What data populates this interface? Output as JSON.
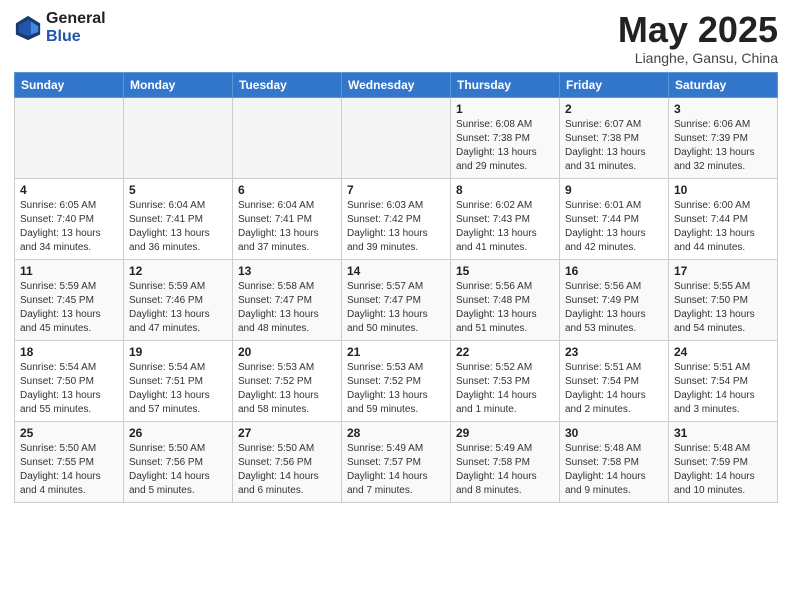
{
  "header": {
    "logo_general": "General",
    "logo_blue": "Blue",
    "month_title": "May 2025",
    "location": "Lianghe, Gansu, China"
  },
  "weekdays": [
    "Sunday",
    "Monday",
    "Tuesday",
    "Wednesday",
    "Thursday",
    "Friday",
    "Saturday"
  ],
  "rows": [
    [
      {
        "day": "",
        "info": ""
      },
      {
        "day": "",
        "info": ""
      },
      {
        "day": "",
        "info": ""
      },
      {
        "day": "",
        "info": ""
      },
      {
        "day": "1",
        "info": "Sunrise: 6:08 AM\nSunset: 7:38 PM\nDaylight: 13 hours\nand 29 minutes."
      },
      {
        "day": "2",
        "info": "Sunrise: 6:07 AM\nSunset: 7:38 PM\nDaylight: 13 hours\nand 31 minutes."
      },
      {
        "day": "3",
        "info": "Sunrise: 6:06 AM\nSunset: 7:39 PM\nDaylight: 13 hours\nand 32 minutes."
      }
    ],
    [
      {
        "day": "4",
        "info": "Sunrise: 6:05 AM\nSunset: 7:40 PM\nDaylight: 13 hours\nand 34 minutes."
      },
      {
        "day": "5",
        "info": "Sunrise: 6:04 AM\nSunset: 7:41 PM\nDaylight: 13 hours\nand 36 minutes."
      },
      {
        "day": "6",
        "info": "Sunrise: 6:04 AM\nSunset: 7:41 PM\nDaylight: 13 hours\nand 37 minutes."
      },
      {
        "day": "7",
        "info": "Sunrise: 6:03 AM\nSunset: 7:42 PM\nDaylight: 13 hours\nand 39 minutes."
      },
      {
        "day": "8",
        "info": "Sunrise: 6:02 AM\nSunset: 7:43 PM\nDaylight: 13 hours\nand 41 minutes."
      },
      {
        "day": "9",
        "info": "Sunrise: 6:01 AM\nSunset: 7:44 PM\nDaylight: 13 hours\nand 42 minutes."
      },
      {
        "day": "10",
        "info": "Sunrise: 6:00 AM\nSunset: 7:44 PM\nDaylight: 13 hours\nand 44 minutes."
      }
    ],
    [
      {
        "day": "11",
        "info": "Sunrise: 5:59 AM\nSunset: 7:45 PM\nDaylight: 13 hours\nand 45 minutes."
      },
      {
        "day": "12",
        "info": "Sunrise: 5:59 AM\nSunset: 7:46 PM\nDaylight: 13 hours\nand 47 minutes."
      },
      {
        "day": "13",
        "info": "Sunrise: 5:58 AM\nSunset: 7:47 PM\nDaylight: 13 hours\nand 48 minutes."
      },
      {
        "day": "14",
        "info": "Sunrise: 5:57 AM\nSunset: 7:47 PM\nDaylight: 13 hours\nand 50 minutes."
      },
      {
        "day": "15",
        "info": "Sunrise: 5:56 AM\nSunset: 7:48 PM\nDaylight: 13 hours\nand 51 minutes."
      },
      {
        "day": "16",
        "info": "Sunrise: 5:56 AM\nSunset: 7:49 PM\nDaylight: 13 hours\nand 53 minutes."
      },
      {
        "day": "17",
        "info": "Sunrise: 5:55 AM\nSunset: 7:50 PM\nDaylight: 13 hours\nand 54 minutes."
      }
    ],
    [
      {
        "day": "18",
        "info": "Sunrise: 5:54 AM\nSunset: 7:50 PM\nDaylight: 13 hours\nand 55 minutes."
      },
      {
        "day": "19",
        "info": "Sunrise: 5:54 AM\nSunset: 7:51 PM\nDaylight: 13 hours\nand 57 minutes."
      },
      {
        "day": "20",
        "info": "Sunrise: 5:53 AM\nSunset: 7:52 PM\nDaylight: 13 hours\nand 58 minutes."
      },
      {
        "day": "21",
        "info": "Sunrise: 5:53 AM\nSunset: 7:52 PM\nDaylight: 13 hours\nand 59 minutes."
      },
      {
        "day": "22",
        "info": "Sunrise: 5:52 AM\nSunset: 7:53 PM\nDaylight: 14 hours\nand 1 minute."
      },
      {
        "day": "23",
        "info": "Sunrise: 5:51 AM\nSunset: 7:54 PM\nDaylight: 14 hours\nand 2 minutes."
      },
      {
        "day": "24",
        "info": "Sunrise: 5:51 AM\nSunset: 7:54 PM\nDaylight: 14 hours\nand 3 minutes."
      }
    ],
    [
      {
        "day": "25",
        "info": "Sunrise: 5:50 AM\nSunset: 7:55 PM\nDaylight: 14 hours\nand 4 minutes."
      },
      {
        "day": "26",
        "info": "Sunrise: 5:50 AM\nSunset: 7:56 PM\nDaylight: 14 hours\nand 5 minutes."
      },
      {
        "day": "27",
        "info": "Sunrise: 5:50 AM\nSunset: 7:56 PM\nDaylight: 14 hours\nand 6 minutes."
      },
      {
        "day": "28",
        "info": "Sunrise: 5:49 AM\nSunset: 7:57 PM\nDaylight: 14 hours\nand 7 minutes."
      },
      {
        "day": "29",
        "info": "Sunrise: 5:49 AM\nSunset: 7:58 PM\nDaylight: 14 hours\nand 8 minutes."
      },
      {
        "day": "30",
        "info": "Sunrise: 5:48 AM\nSunset: 7:58 PM\nDaylight: 14 hours\nand 9 minutes."
      },
      {
        "day": "31",
        "info": "Sunrise: 5:48 AM\nSunset: 7:59 PM\nDaylight: 14 hours\nand 10 minutes."
      }
    ]
  ]
}
